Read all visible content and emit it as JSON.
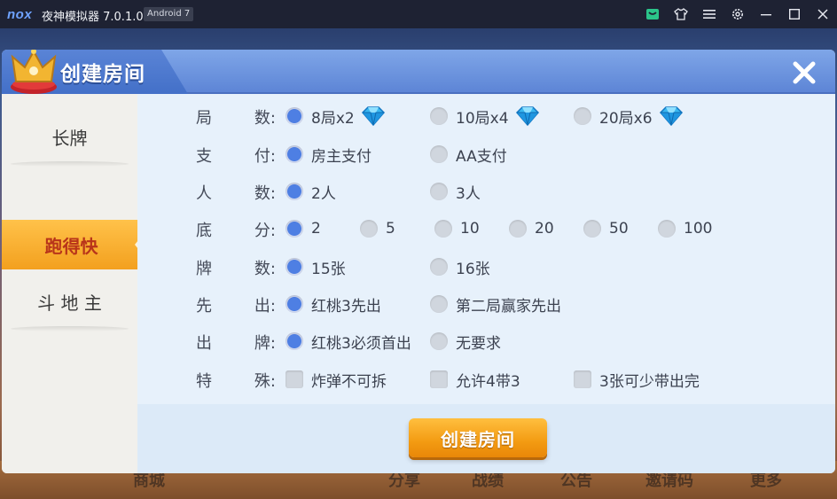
{
  "titlebar": {
    "logo": "nox",
    "title": "夜神模拟器 7.0.1.0",
    "badge": "Android 7",
    "icons": [
      "shop-icon",
      "shirt-icon",
      "menu-icon",
      "settings-icon",
      "minimize-icon",
      "maximize-icon",
      "close-icon"
    ]
  },
  "background": {
    "bottom_labels": [
      "商城",
      "分享",
      "战绩",
      "公告",
      "邀请码",
      "更多"
    ]
  },
  "dialog": {
    "title": "创建房间",
    "tabs": [
      {
        "label": "长牌",
        "active": false
      },
      {
        "label": "跑得快",
        "active": true
      },
      {
        "label": "斗 地 主",
        "active": false
      }
    ],
    "rows": [
      {
        "label": [
          "局",
          "数:"
        ],
        "type": "radio",
        "options": [
          {
            "text": "8局x2",
            "selected": true,
            "gem": true
          },
          {
            "text": "10局x4",
            "selected": false,
            "gem": true
          },
          {
            "text": "20局x6",
            "selected": false,
            "gem": true
          }
        ]
      },
      {
        "label": [
          "支",
          "付:"
        ],
        "type": "radio",
        "options": [
          {
            "text": "房主支付",
            "selected": true
          },
          {
            "text": "AA支付",
            "selected": false
          }
        ]
      },
      {
        "label": [
          "人",
          "数:"
        ],
        "type": "radio",
        "options": [
          {
            "text": "2人",
            "selected": true
          },
          {
            "text": "3人",
            "selected": false
          }
        ]
      },
      {
        "label": [
          "底",
          "分:"
        ],
        "type": "radio",
        "options": [
          {
            "text": "2",
            "selected": true
          },
          {
            "text": "5",
            "selected": false
          },
          {
            "text": "10",
            "selected": false
          },
          {
            "text": "20",
            "selected": false
          },
          {
            "text": "50",
            "selected": false
          },
          {
            "text": "100",
            "selected": false
          }
        ]
      },
      {
        "label": [
          "牌",
          "数:"
        ],
        "type": "radio",
        "options": [
          {
            "text": "15张",
            "selected": true
          },
          {
            "text": "16张",
            "selected": false
          }
        ]
      },
      {
        "label": [
          "先",
          "出:"
        ],
        "type": "radio",
        "options": [
          {
            "text": "红桃3先出",
            "selected": true
          },
          {
            "text": "第二局赢家先出",
            "selected": false
          }
        ]
      },
      {
        "label": [
          "出",
          "牌:"
        ],
        "type": "radio",
        "options": [
          {
            "text": "红桃3必须首出",
            "selected": true
          },
          {
            "text": "无要求",
            "selected": false
          }
        ]
      },
      {
        "label": [
          "特",
          "殊:"
        ],
        "type": "checkbox",
        "options": [
          {
            "text": "炸弹不可拆",
            "selected": false
          },
          {
            "text": "允许4带3",
            "selected": false
          },
          {
            "text": "3张可少带出完",
            "selected": false
          }
        ]
      }
    ],
    "create_button": "创建房间"
  },
  "colors": {
    "accent_blue": "#4e7fe3",
    "tab_active": "#f3a01e",
    "button_orange": "#f39b12"
  }
}
